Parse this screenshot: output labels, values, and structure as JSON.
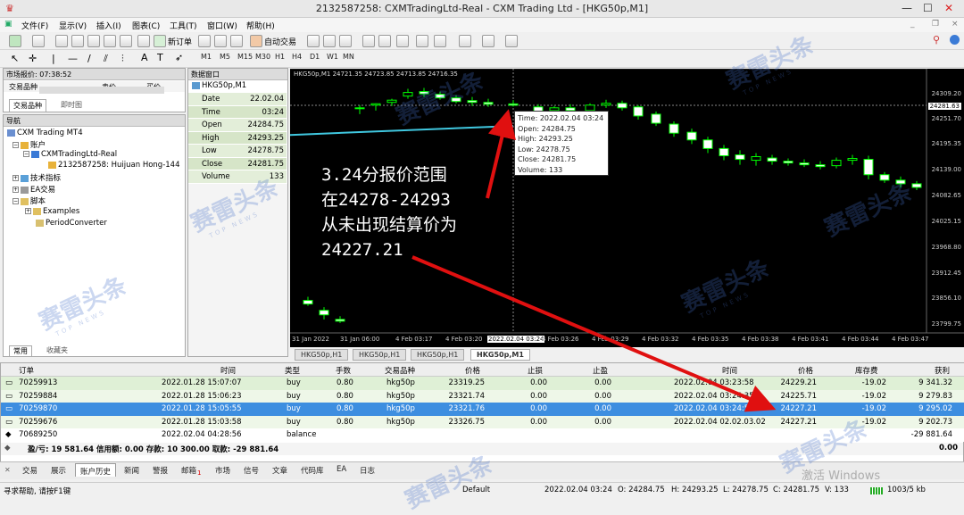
{
  "window": {
    "title": "2132587258: CXMTradingLtd-Real - CXM Trading Ltd - [HKG50p,M1]",
    "controls": [
      "—",
      "☐",
      "✕"
    ]
  },
  "menu": [
    "文件(F)",
    "显示(V)",
    "插入(I)",
    "图表(C)",
    "工具(T)",
    "窗口(W)",
    "帮助(H)"
  ],
  "toolbar": {
    "new_order": "新订单",
    "auto_trading": "自动交易",
    "timeframes": [
      "M1",
      "M5",
      "M15",
      "M30",
      "H1",
      "H4",
      "D1",
      "W1",
      "MN"
    ]
  },
  "market_watch": {
    "title": "市场报价: 07:38:52",
    "cols": [
      "交易品种",
      "卖价",
      "买价"
    ],
    "tabs": [
      "交易品种",
      "即时图"
    ]
  },
  "data_window": {
    "title": "数据窗口",
    "symbol": "HKG50p,M1",
    "rows": [
      {
        "k": "Date",
        "v": "22.02.04"
      },
      {
        "k": "Time",
        "v": "03:24"
      },
      {
        "k": "Open",
        "v": "24284.75"
      },
      {
        "k": "High",
        "v": "24293.25"
      },
      {
        "k": "Low",
        "v": "24278.75"
      },
      {
        "k": "Close",
        "v": "24281.75"
      },
      {
        "k": "Volume",
        "v": "133"
      }
    ]
  },
  "navigator": {
    "title": "导航",
    "items": [
      {
        "t": "CXM Trading MT4",
        "lvl": 0
      },
      {
        "t": "账户",
        "lvl": 1
      },
      {
        "t": "CXMTradingLtd-Real",
        "lvl": 2
      },
      {
        "t": "2132587258: Huijuan Hong-144",
        "lvl": 3
      },
      {
        "t": "技术指标",
        "lvl": 1
      },
      {
        "t": "EA交易",
        "lvl": 1
      },
      {
        "t": "脚本",
        "lvl": 1
      },
      {
        "t": "Examples",
        "lvl": 2
      },
      {
        "t": "PeriodConverter",
        "lvl": 2
      }
    ],
    "tabs": [
      "常用",
      "收藏夹"
    ]
  },
  "chart": {
    "header": "HKG50p,M1  24721.35 24723.85 24713.85 24716.35",
    "price_labels": [
      "24309.20",
      "24251.70",
      "24195.35",
      "24139.00",
      "24082.65",
      "24025.15",
      "23968.80",
      "23912.45",
      "23856.10",
      "23799.75"
    ],
    "current_price": "24281.63",
    "time_labels": [
      "31 Jan 2022",
      "31 Jan 06:00",
      "4 Feb 03:17",
      "4 Feb 03:20",
      "2022.02.04 03:24",
      "4 Feb 03:26",
      "4 Feb 03:29",
      "4 Feb 03:32",
      "4 Feb 03:35",
      "4 Feb 03:38",
      "4 Feb 03:41",
      "4 Feb 03:44",
      "4 Feb 03:47"
    ],
    "tooltip": [
      "Time: 2022.02.04 03:24",
      "Open: 24284.75",
      "High: 24293.25",
      "Low: 24278.75",
      "Close: 24281.75",
      "Volume: 133"
    ],
    "annotation": [
      "3.24分报价范围",
      "在24278-24293",
      "从未出现结算价为",
      "24227.21"
    ],
    "tabs": [
      "HKG50p,H1",
      "HKG50p,H1",
      "HKG50p,H1",
      "HKG50p,M1"
    ],
    "colors": {
      "bg": "#000000",
      "candle": "#00ff00",
      "line": "#40c8e0",
      "arrow": "#e01010"
    }
  },
  "terminal": {
    "headers": [
      "订单",
      "时间",
      "类型",
      "手数",
      "交易品种",
      "价格",
      "止损",
      "止盈",
      "时间",
      "价格",
      "库存费",
      "获利"
    ],
    "rows": [
      [
        "70259913",
        "2022.01.28 15:07:07",
        "buy",
        "0.80",
        "hkg50p",
        "23319.25",
        "0.00",
        "0.00",
        "2022.02.04 03:23:58",
        "24229.21",
        "-19.02",
        "9 341.32"
      ],
      [
        "70259884",
        "2022.01.28 15:06:23",
        "buy",
        "0.80",
        "hkg50p",
        "23321.74",
        "0.00",
        "0.00",
        "2022.02.04 03:24:35",
        "24225.71",
        "-19.02",
        "9 279.83"
      ],
      [
        "70259870",
        "2022.01.28 15:05:55",
        "buy",
        "0.80",
        "hkg50p",
        "23321.76",
        "0.00",
        "0.00",
        "2022.02.04 03:24:52",
        "24227.21",
        "-19.02",
        "9 295.02"
      ],
      [
        "70259676",
        "2022.01.28 15:03:58",
        "buy",
        "0.80",
        "hkg50p",
        "23326.75",
        "0.00",
        "0.00",
        "2022.02.04 02.02.03.02",
        "24227.21",
        "-19.02",
        "9 202.73"
      ],
      [
        "70689250",
        "2022.02.04 04:28:56",
        "balance",
        "",
        "",
        "",
        "",
        "",
        "",
        "",
        "",
        "-29 881.64"
      ]
    ],
    "summary": "盈/亏: 19 581.64  信用额: 0.00  存款: 10 300.00  取款: -29 881.64",
    "summary_value": "0.00",
    "tabs": [
      "交易",
      "展示",
      "账户历史",
      "新闻",
      "警报",
      "邮箱",
      "市场",
      "信号",
      "文章",
      "代码库",
      "EA",
      "日志"
    ],
    "mail_badge": "1"
  },
  "status": {
    "help": "寻求帮助, 请按F1键",
    "profile": "Default",
    "time": "2022.02.04 03:24",
    "open": "O: 24284.75",
    "high": "H: 24293.25",
    "low": "L: 24278.75",
    "close": "C: 24281.75",
    "volume": "V: 133",
    "traffic": "1003/5 kb"
  },
  "watermark": {
    "text": "赛雷头条",
    "sub": "TOP NEWS",
    "activate": "激活 Windows"
  }
}
